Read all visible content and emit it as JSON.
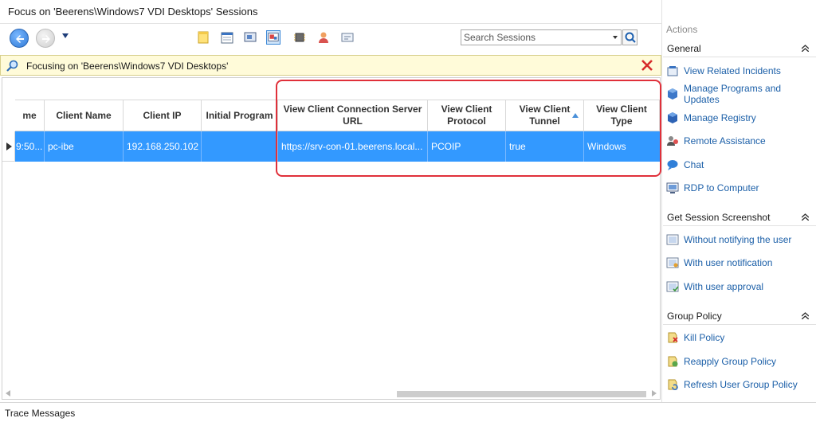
{
  "window": {
    "title": "Focus on 'Beerens\\Windows7 VDI Desktops' Sessions"
  },
  "toolbar": {
    "search_placeholder": "Search Sessions"
  },
  "focus_bar": {
    "text": "Focusing on 'Beerens\\Windows7 VDI Desktops'"
  },
  "grid": {
    "columns": [
      {
        "label": "me"
      },
      {
        "label": "Client Name"
      },
      {
        "label": "Client IP"
      },
      {
        "label": "Initial Program"
      },
      {
        "label": "View Client Connection Server URL"
      },
      {
        "label": "View Client Protocol"
      },
      {
        "label": "View Client Tunnel"
      },
      {
        "label": "View Client Type"
      }
    ],
    "rows": [
      {
        "cells": [
          "9:50...",
          "pc-ibe",
          "192.168.250.102",
          "",
          "https://srv-con-01.beerens.local...",
          "PCOIP",
          "true",
          "Windows"
        ]
      }
    ]
  },
  "actions": {
    "title": "Actions",
    "sections": [
      {
        "label": "General",
        "items": [
          {
            "label": "View Related Incidents",
            "icon": "incidents-icon"
          },
          {
            "label": "Manage Programs and Updates",
            "icon": "programs-icon"
          },
          {
            "label": "Manage Registry",
            "icon": "registry-icon"
          },
          {
            "label": "Remote Assistance",
            "icon": "remote-assistance-icon"
          },
          {
            "label": "Chat",
            "icon": "chat-icon"
          },
          {
            "label": "RDP to Computer",
            "icon": "rdp-icon"
          }
        ]
      },
      {
        "label": "Get Session Screenshot",
        "items": [
          {
            "label": "Without notifying the user",
            "icon": "screenshot-icon"
          },
          {
            "label": "With user notification",
            "icon": "screenshot-notify-icon"
          },
          {
            "label": "With user approval",
            "icon": "screenshot-approval-icon"
          }
        ]
      },
      {
        "label": "Group Policy",
        "items": [
          {
            "label": "Kill Policy",
            "icon": "kill-policy-icon"
          },
          {
            "label": "Reapply Group Policy",
            "icon": "reapply-policy-icon"
          },
          {
            "label": "Refresh User Group Policy",
            "icon": "refresh-policy-icon"
          }
        ]
      }
    ]
  },
  "status_bar": {
    "label": "Trace Messages"
  },
  "colors": {
    "selection": "#3399ff",
    "link": "#1b5fa8",
    "highlight_box": "#e0303a",
    "focus_bar": "#fffbd9"
  }
}
